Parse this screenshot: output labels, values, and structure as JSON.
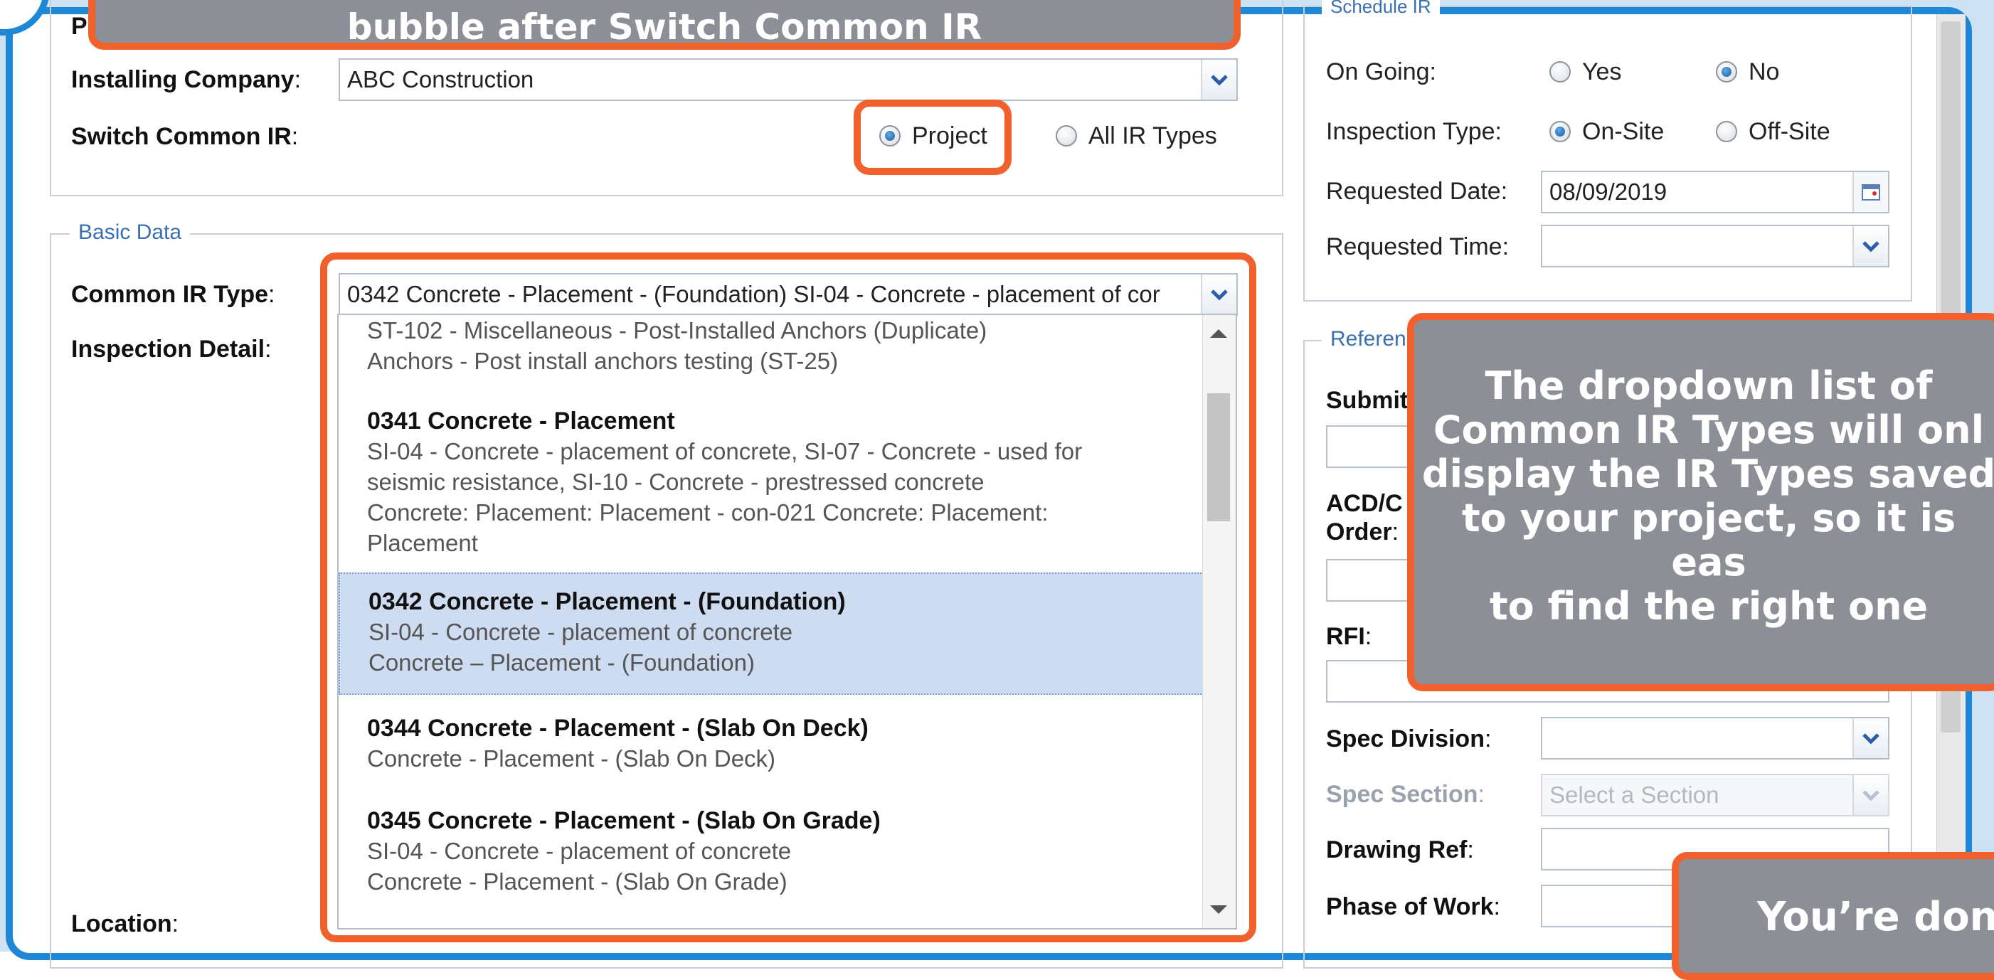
{
  "top_form": {
    "partial_label": "P",
    "installing_company_label": "Installing Company",
    "installing_company_value": "ABC Construction",
    "switch_common_ir_label": "Switch Common IR",
    "options": [
      "Project",
      "All IR Types"
    ],
    "selected": "Project"
  },
  "basic_data": {
    "legend": "Basic Data",
    "common_ir_type_label": "Common IR Type",
    "common_ir_type_value": "0342 Concrete - Placement - (Foundation) SI-04 - Concrete - placement of cor",
    "inspection_detail_label": "Inspection Detail",
    "location_label": "Location"
  },
  "dropdown_options": [
    {
      "title": "",
      "lines": [
        "ST-102 - Miscellaneous - Post-Installed Anchors (Duplicate)",
        "Anchors - Post install anchors testing (ST-25)"
      ]
    },
    {
      "title": "0341 Concrete - Placement",
      "lines": [
        "SI-04 - Concrete - placement of concrete, SI-07 - Concrete - used for",
        "seismic resistance, SI-10 - Concrete - prestressed concrete",
        "Concrete: Placement: Placement - con-021 Concrete: Placement:",
        "Placement"
      ]
    },
    {
      "title": "0342 Concrete - Placement - (Foundation)",
      "lines": [
        "SI-04 - Concrete - placement of concrete",
        "Concrete – Placement - (Foundation)"
      ],
      "selected": true
    },
    {
      "title": "0344 Concrete - Placement - (Slab On Deck)",
      "lines": [
        "Concrete - Placement - (Slab On Deck)"
      ]
    },
    {
      "title": "0345 Concrete - Placement - (Slab On Grade)",
      "lines": [
        "SI-04 - Concrete - placement of concrete",
        "Concrete - Placement - (Slab On Grade)"
      ]
    }
  ],
  "schedule_ir": {
    "legend": "Schedule IR",
    "on_going_label": "On Going:",
    "on_going_options": [
      "Yes",
      "No"
    ],
    "on_going_selected": "No",
    "inspection_type_label": "Inspection Type:",
    "inspection_type_options": [
      "On-Site",
      "Off-Site"
    ],
    "inspection_type_selected": "On-Site",
    "requested_date_label": "Requested Date:",
    "requested_date_value": "08/09/2019",
    "requested_time_label": "Requested Time:",
    "requested_time_value": ""
  },
  "references": {
    "legend": "Referen",
    "submit_label": "Submit",
    "acd_label_line1": "ACD/C",
    "acd_label_line2": "Order",
    "rfi_label": "RFI",
    "spec_division_label": "Spec Division",
    "spec_section_label": "Spec Section",
    "spec_section_placeholder": "Select a Section",
    "drawing_ref_label": "Drawing Ref",
    "phase_of_work_label": "Phase of Work"
  },
  "callouts": {
    "top_bubble": "bubble after Switch Common IR",
    "dropdown_bubble_lines": [
      "The dropdown list of",
      "Common IR Types will onl",
      "display the IR Types saved",
      "to your project, so it is eas",
      "to find the right one"
    ],
    "done_bubble": "You’re done"
  },
  "colors": {
    "frame_blue": "#1e88d6",
    "callout_orange": "#f0612e",
    "bubble_gray": "#8c9096",
    "selected_row": "#cddcf1",
    "legend_blue": "#3a6fb0"
  }
}
